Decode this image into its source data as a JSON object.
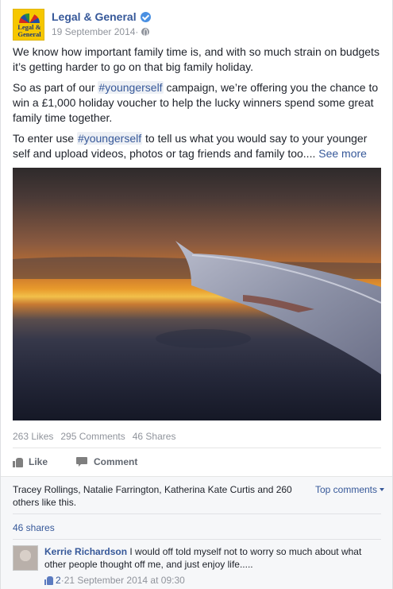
{
  "post": {
    "page_name": "Legal & General",
    "logo_text_line1": "Legal &",
    "logo_text_line2": "General",
    "date": "19 September 2014",
    "date_separator": " · ",
    "paragraphs": {
      "p1": "We know how important family time is, and with so much strain on budgets it’s getting harder to go on that big family holiday.",
      "p2_before": "So as part of our ",
      "p2_hashtag": "#youngerself",
      "p2_after": " campaign, we’re offering you the chance to win a £1,000 holiday voucher to help the lucky winners spend some great family time together.",
      "p3_before": "To enter use ",
      "p3_hashtag": "#youngerself",
      "p3_after": " to tell us what you would say to your younger self and upload videos, photos or tag friends and family too....",
      "see_more": "See more"
    }
  },
  "stats": {
    "likes": "263 Likes",
    "comments": "295 Comments",
    "shares": "46 Shares"
  },
  "actions": {
    "like_label": "Like",
    "comment_label": "Comment"
  },
  "ufi": {
    "likers_text": "Tracey Rollings, Natalie Farrington, Katherina Kate Curtis and 260 others like this.",
    "top_comments_label": "Top comments",
    "shares_link": "46 shares"
  },
  "comment": {
    "author": "Kerrie Richardson",
    "text": "I would off told myself not to worry so much about what other people thought off me, and just enjoy life.....",
    "likes_count": "2",
    "timestamp": "21 September 2014 at 09:30",
    "separator": " · "
  },
  "colors": {
    "link": "#365899",
    "muted": "#90949c",
    "ufi_background": "#f6f7f9"
  },
  "icons": [
    "verified-badge-icon",
    "globe-icon",
    "like-icon",
    "comment-icon",
    "caret-down-icon",
    "comment-like-icon"
  ]
}
